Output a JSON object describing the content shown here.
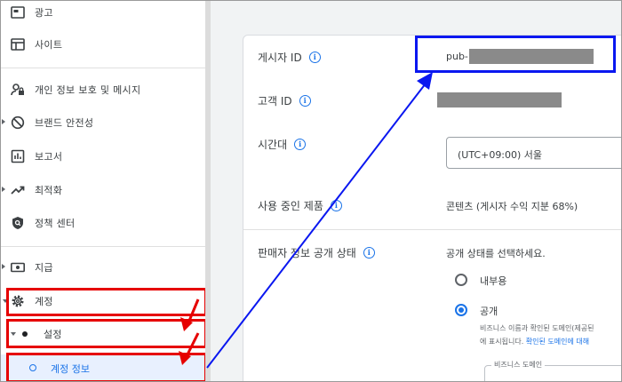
{
  "sidebar": {
    "items": [
      {
        "label": "광고",
        "icon": "ad-icon"
      },
      {
        "label": "사이트",
        "icon": "site-icon"
      },
      {
        "label": "개인 정보 보호 및 메시지",
        "icon": "privacy-icon"
      },
      {
        "label": "브랜드 안전성",
        "icon": "block-icon"
      },
      {
        "label": "보고서",
        "icon": "report-icon"
      },
      {
        "label": "최적화",
        "icon": "trend-icon"
      },
      {
        "label": "정책 센터",
        "icon": "shield-icon"
      },
      {
        "label": "지급",
        "icon": "payment-icon"
      },
      {
        "label": "계정",
        "icon": "gear-icon"
      }
    ],
    "settings_label": "설정",
    "account_info_label": "계정 정보"
  },
  "account": {
    "publisher_id_label": "게시자 ID",
    "publisher_id_prefix": "pub-",
    "customer_id_label": "고객 ID",
    "timezone_label": "시간대",
    "timezone_value": "(UTC+09:00) 서울",
    "product_label": "사용 중인 제품",
    "product_value": "콘텐츠 (게시자 수익 지분 68%)",
    "seller_label": "판매자 정보 공개 상태",
    "seller_prompt": "공개 상태를 선택하세요.",
    "option_internal": "내부용",
    "option_public": "공개",
    "public_desc_line1": "비즈니스 이름과 확인된 도메인(제공된",
    "public_desc_line2_pre": "에 표시됩니다.",
    "public_desc_link": "확인된 도메인에 대해",
    "business_domain_label": "비즈니스 도메인",
    "info_glyph": "i"
  },
  "colors": {
    "annotation_red": "#e60000",
    "annotation_blue": "#0a17f0",
    "accent": "#1a73e8"
  }
}
